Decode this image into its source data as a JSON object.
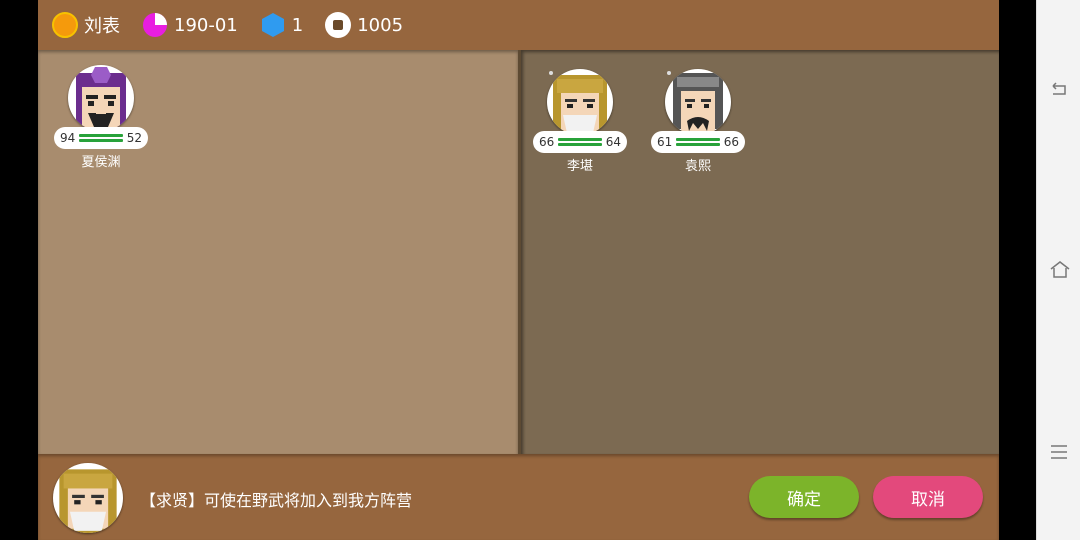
{
  "topbar": {
    "lord_name": "刘表",
    "date": "190-01",
    "gems": "1",
    "coins": "1005"
  },
  "left_panel": {
    "generals": [
      {
        "name": "夏侯渊",
        "stat_left": "94",
        "stat_right": "52",
        "face": "purple-helmet-general"
      }
    ]
  },
  "right_panel": {
    "generals": [
      {
        "name": "李堪",
        "stat_left": "66",
        "stat_right": "64",
        "face": "gold-helmet-general"
      },
      {
        "name": "袁熙",
        "stat_left": "61",
        "stat_right": "66",
        "face": "gray-helmet-general"
      }
    ]
  },
  "bottom": {
    "description": "【求贤】可使在野武将加入到我方阵营",
    "confirm_label": "确定",
    "cancel_label": "取消"
  },
  "colors": {
    "accent_ok": "#7cb42a",
    "accent_cancel": "#e3497c",
    "panel": "#96663e"
  }
}
